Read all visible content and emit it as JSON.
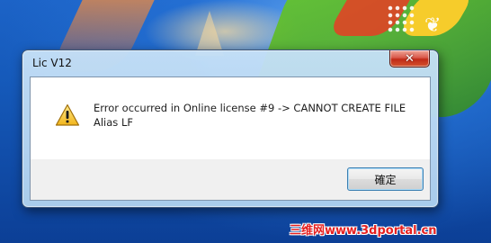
{
  "dialog": {
    "title": "Lic V12",
    "close_symbol": "✕",
    "icon": "warning-icon",
    "message_line1": "Error occurred in Online license #9 -> CANNOT CREATE FILE",
    "message_line2": "Alias LF",
    "ok_label": "確定"
  },
  "desktop": {
    "butterfly_icon": "butterfly-icon"
  },
  "watermark": {
    "text": "三维网www.3dportal.cn"
  },
  "colors": {
    "title_bar": "#c5e0f7",
    "close_button": "#c7321f",
    "warning_yellow": "#f7c93a",
    "watermark_red": "#e62020"
  }
}
